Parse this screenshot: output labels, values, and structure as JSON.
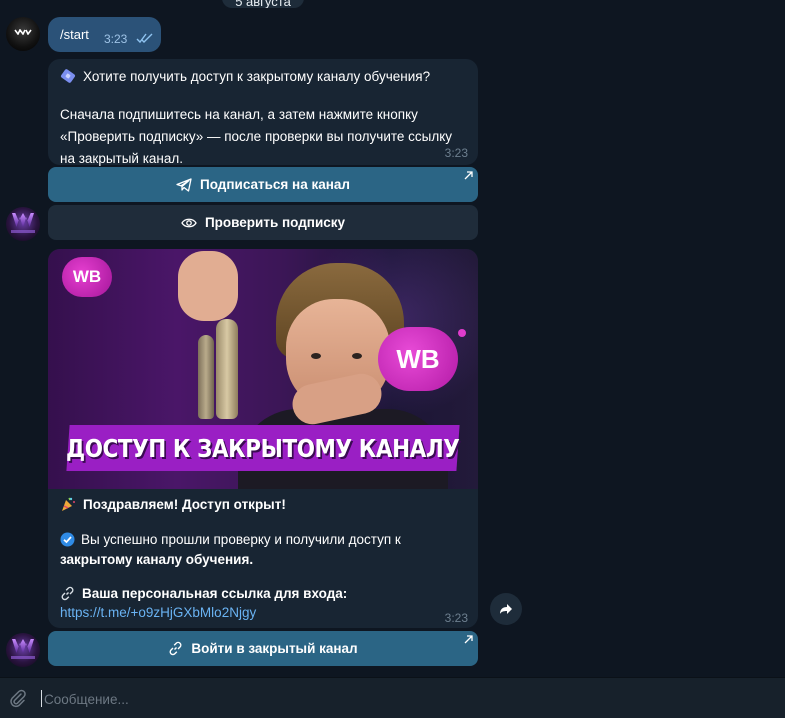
{
  "date_pill": {
    "label": "5 августа"
  },
  "outgoing": {
    "text": "/start",
    "time": "3:23"
  },
  "message1": {
    "headline": "Хотите получить доступ к закрытому каналу обучения?",
    "body": "Сначала подпишитесь на канал, а затем нажмите кнопку «Проверить подписку» — после проверки вы получите ссылку на закрытый канал.",
    "time": "3:23"
  },
  "keyboard1": {
    "subscribe_label": "Подписаться на канал",
    "check_label": "Проверить подписку"
  },
  "message2": {
    "image": {
      "badge_small": "WB",
      "badge_big": "WB",
      "banner_text": "ДОСТУП К ЗАКРЫТОМУ КАНАЛУ"
    },
    "congrats": "Поздравляем! Доступ открыт!",
    "success_plain": "Вы успешно прошли проверку и получили доступ к ",
    "success_bold": "закрытому каналу обучения.",
    "personal_label": "Ваша персональная ссылка для входа:",
    "link": "https://t.me/+o9zHjGXbMlo2Njgy",
    "time": "3:23"
  },
  "keyboard2": {
    "enter_label": "Войти в закрытый канал"
  },
  "composer": {
    "placeholder": "Сообщение..."
  },
  "colors": {
    "background": "#0e1621",
    "outgoing_bubble": "#2b5278",
    "incoming_bubble": "#182533",
    "keyboard_primary": "#2b6585",
    "link": "#6ab3f3",
    "banner": "#9a1fc4"
  }
}
